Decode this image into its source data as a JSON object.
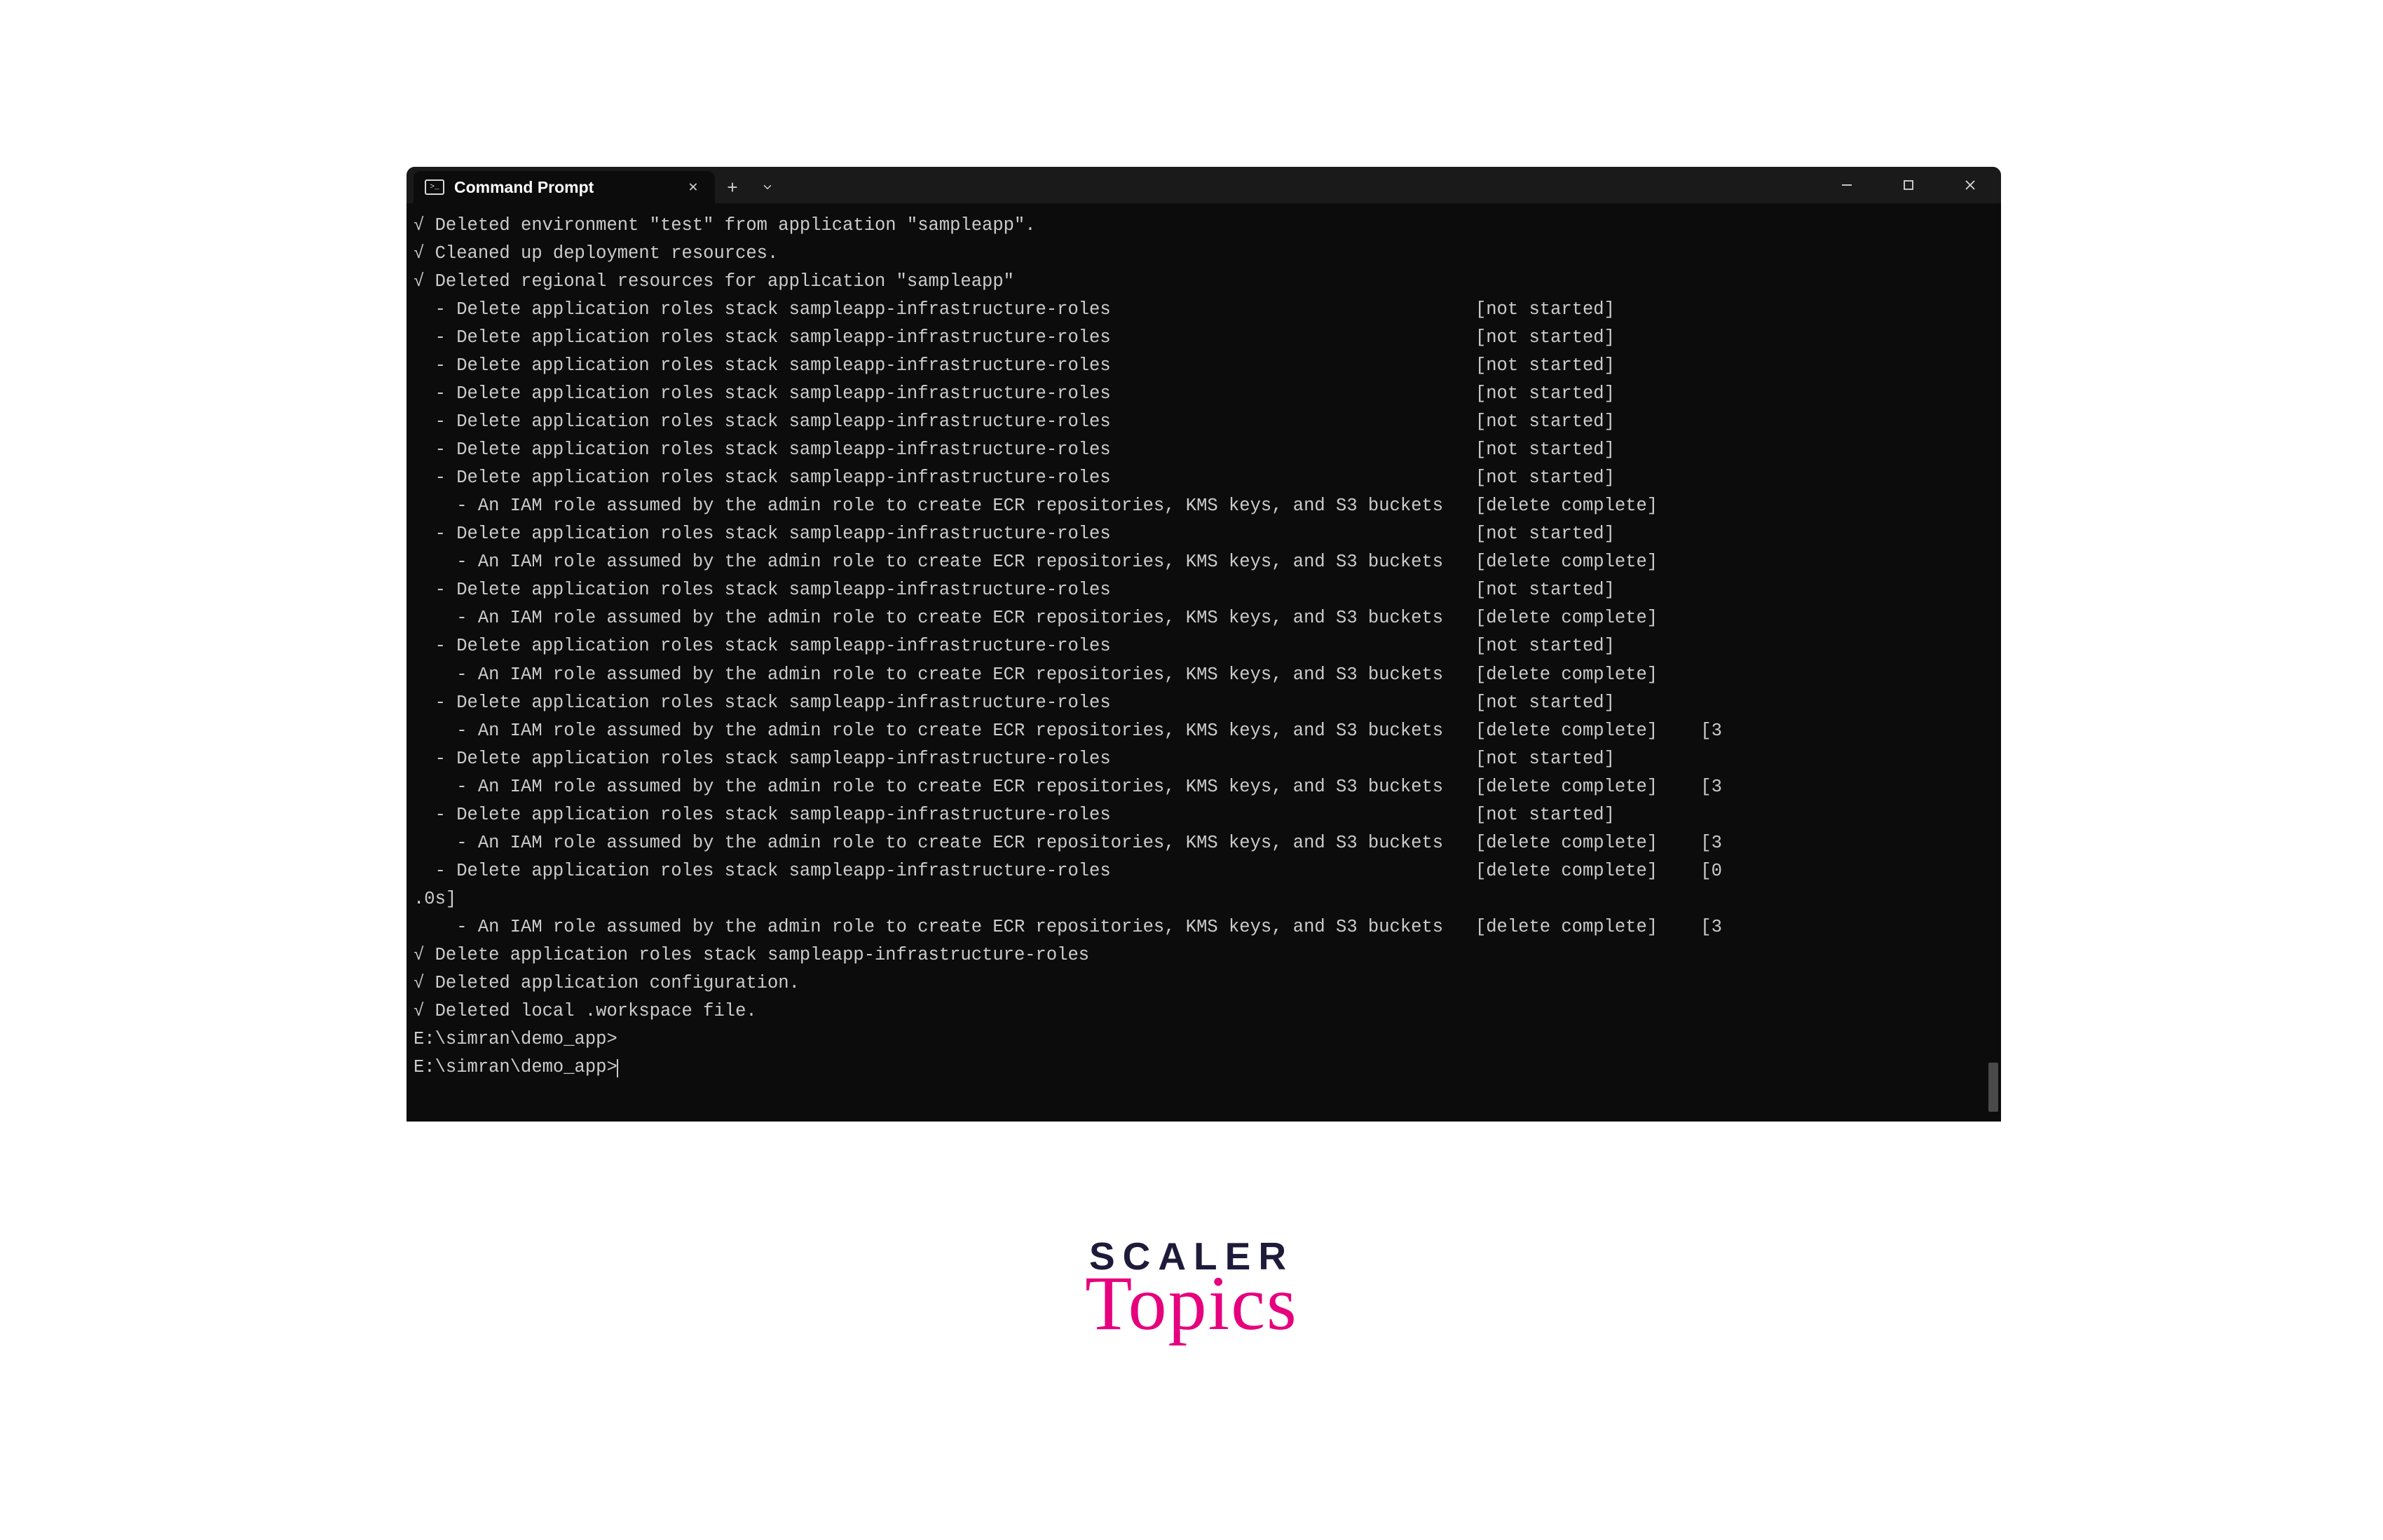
{
  "window": {
    "tab_title": "Command Prompt"
  },
  "terminal": {
    "lines": [
      "√ Deleted environment \"test\" from application \"sampleapp\".",
      "√ Cleaned up deployment resources.",
      "√ Deleted regional resources for application \"sampleapp\"",
      "  - Delete application roles stack sampleapp-infrastructure-roles                                  [not started]",
      "  - Delete application roles stack sampleapp-infrastructure-roles                                  [not started]",
      "  - Delete application roles stack sampleapp-infrastructure-roles                                  [not started]",
      "  - Delete application roles stack sampleapp-infrastructure-roles                                  [not started]",
      "  - Delete application roles stack sampleapp-infrastructure-roles                                  [not started]",
      "  - Delete application roles stack sampleapp-infrastructure-roles                                  [not started]",
      "  - Delete application roles stack sampleapp-infrastructure-roles                                  [not started]",
      "    - An IAM role assumed by the admin role to create ECR repositories, KMS keys, and S3 buckets   [delete complete]",
      "  - Delete application roles stack sampleapp-infrastructure-roles                                  [not started]",
      "    - An IAM role assumed by the admin role to create ECR repositories, KMS keys, and S3 buckets   [delete complete]",
      "  - Delete application roles stack sampleapp-infrastructure-roles                                  [not started]",
      "    - An IAM role assumed by the admin role to create ECR repositories, KMS keys, and S3 buckets   [delete complete]",
      "  - Delete application roles stack sampleapp-infrastructure-roles                                  [not started]",
      "    - An IAM role assumed by the admin role to create ECR repositories, KMS keys, and S3 buckets   [delete complete]",
      "  - Delete application roles stack sampleapp-infrastructure-roles                                  [not started]",
      "    - An IAM role assumed by the admin role to create ECR repositories, KMS keys, and S3 buckets   [delete complete]    [3",
      "  - Delete application roles stack sampleapp-infrastructure-roles                                  [not started]",
      "    - An IAM role assumed by the admin role to create ECR repositories, KMS keys, and S3 buckets   [delete complete]    [3",
      "  - Delete application roles stack sampleapp-infrastructure-roles                                  [not started]",
      "    - An IAM role assumed by the admin role to create ECR repositories, KMS keys, and S3 buckets   [delete complete]    [3",
      "  - Delete application roles stack sampleapp-infrastructure-roles                                  [delete complete]    [0",
      ".0s]",
      "    - An IAM role assumed by the admin role to create ECR repositories, KMS keys, and S3 buckets   [delete complete]    [3",
      "√ Delete application roles stack sampleapp-infrastructure-roles",
      "√ Deleted application configuration.",
      "√ Deleted local .workspace file.",
      "",
      "E:\\simran\\demo_app>",
      "E:\\simran\\demo_app>"
    ]
  },
  "watermark": {
    "line1": "SCALER",
    "line2": "Topics"
  }
}
